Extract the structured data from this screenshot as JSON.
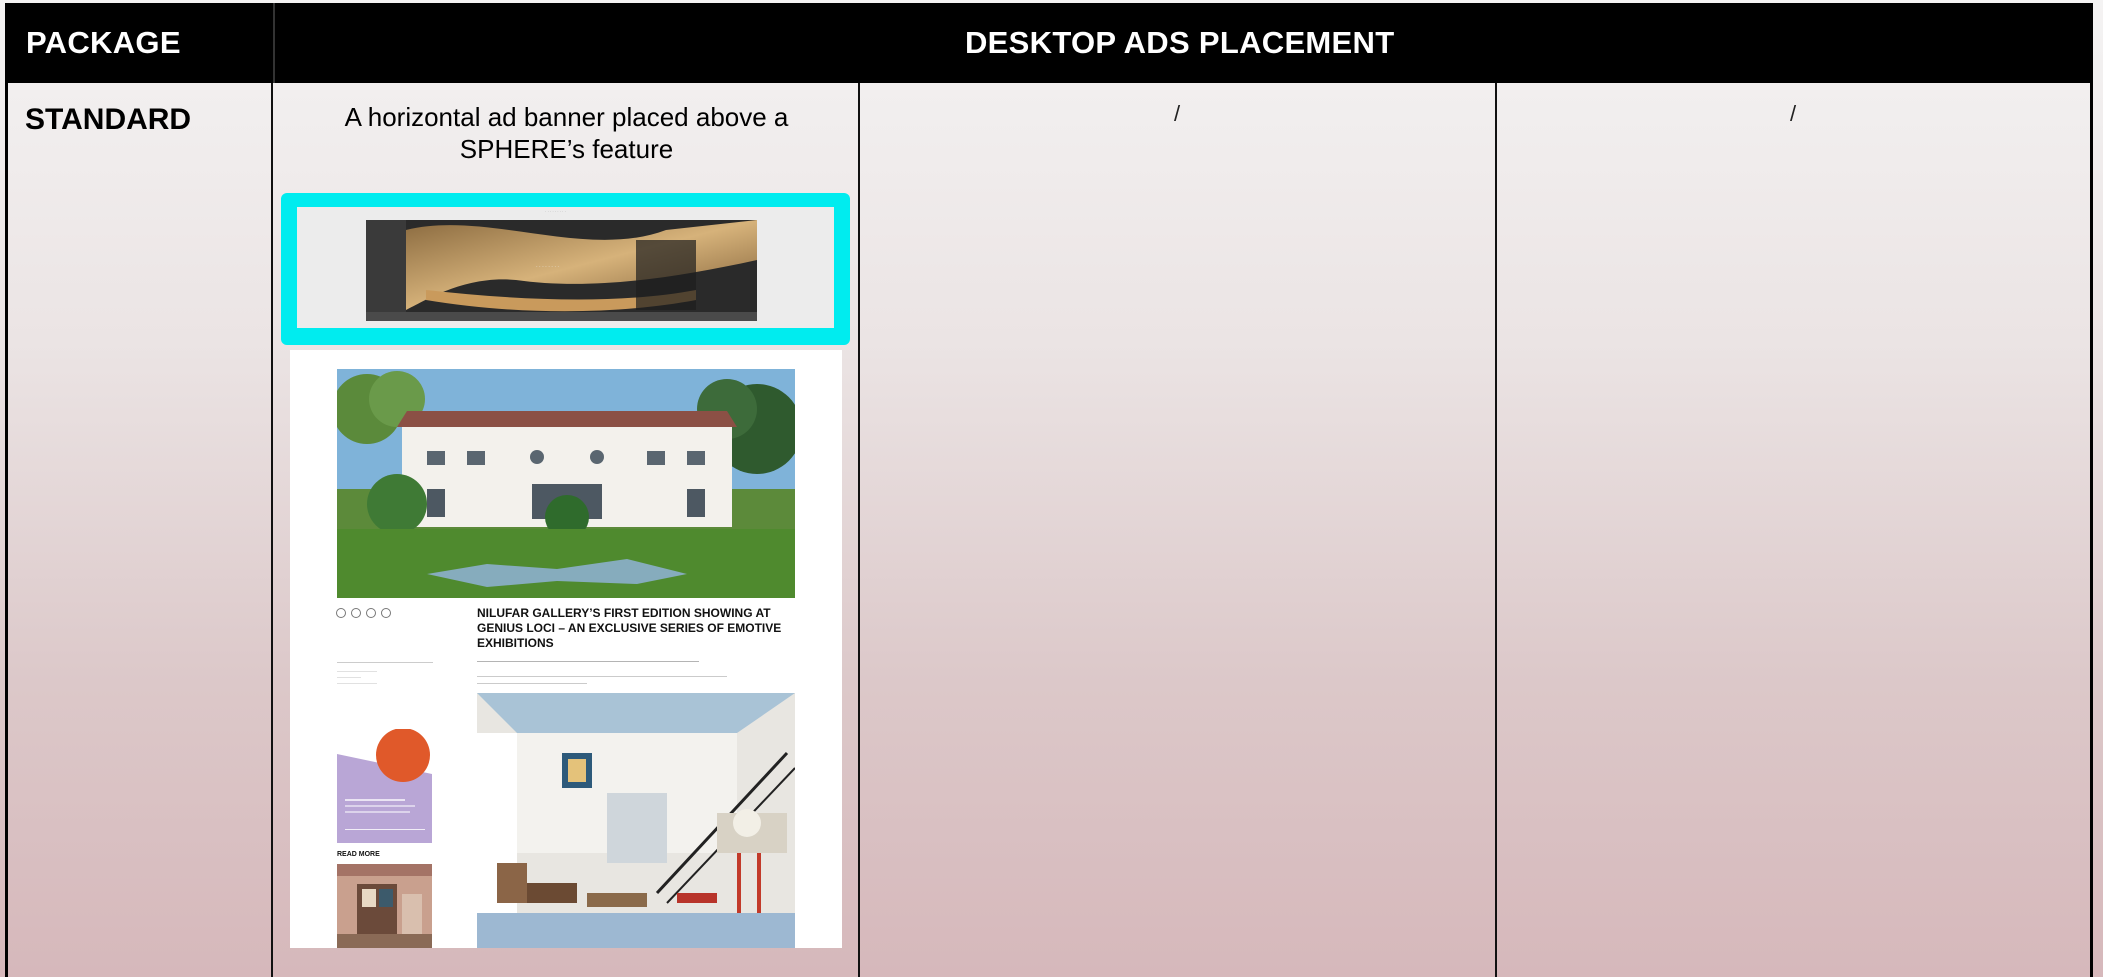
{
  "header": {
    "package_label": "PACKAGE",
    "placement_label": "DESKTOP ADS PLACEMENT"
  },
  "row": {
    "package_name": "STANDARD",
    "description": "A horizontal ad banner placed above a SPHERE’s feature",
    "placeholder_col3": "/",
    "placeholder_col4": "/"
  },
  "mockup": {
    "article_title": "NILUFAR GALLERY’S FIRST EDITION SHOWING AT GENIUS LOCI – AN EXCLUSIVE SERIES OF EMOTIVE EXHIBITIONS",
    "read_more": "READ MORE"
  },
  "colors": {
    "highlight": "#00ecef",
    "header_bg": "#000000",
    "header_text": "#ffffff"
  }
}
